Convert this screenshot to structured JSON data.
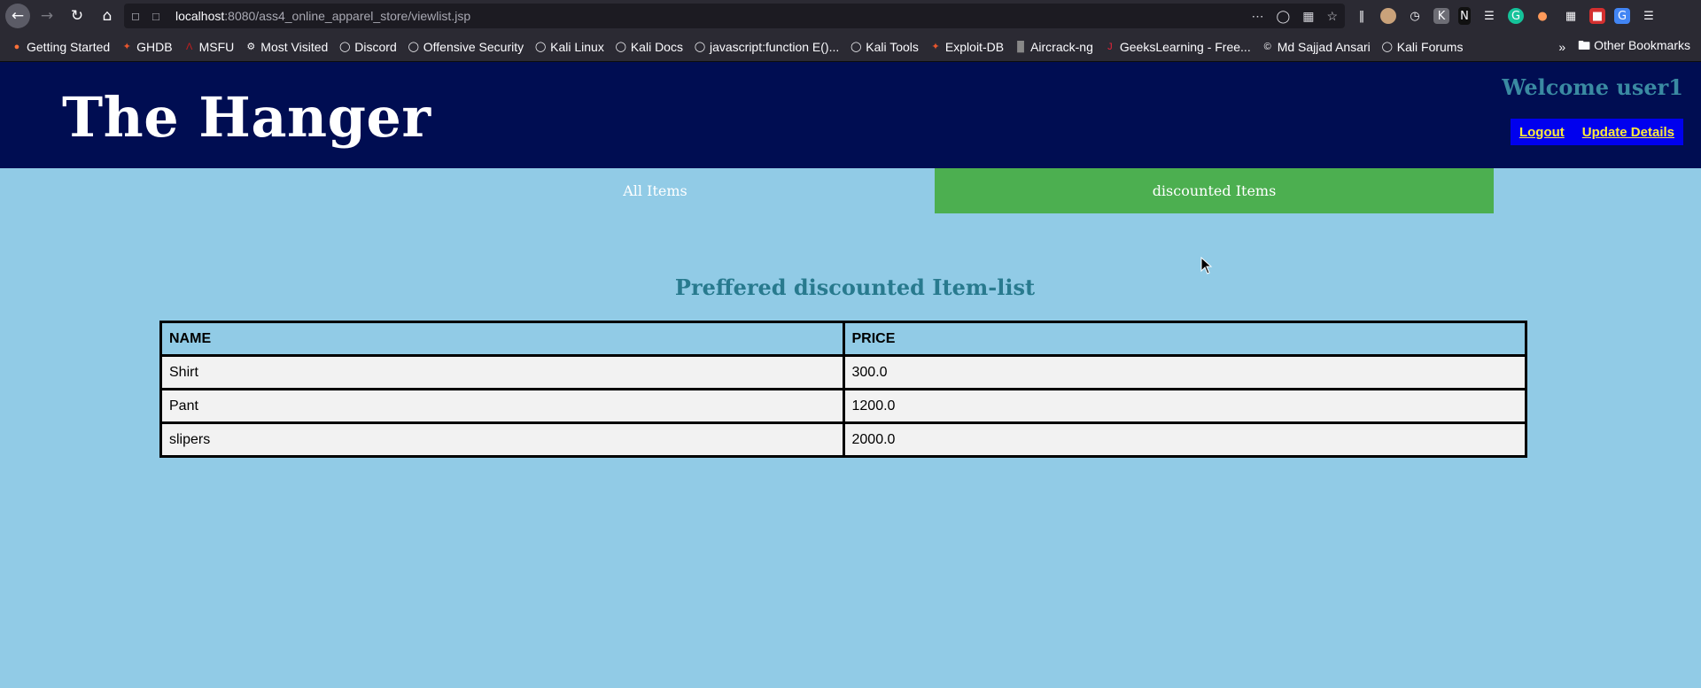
{
  "browser": {
    "url_host": "localhost",
    "url_rest": ":8080/ass4_online_apparel_store/viewlist.jsp",
    "bookmarks": [
      {
        "label": "Getting Started",
        "icon": "firefox-icon",
        "color": "#ff7139"
      },
      {
        "label": "GHDB",
        "icon": "exploit-db-icon",
        "color": "#e8552d"
      },
      {
        "label": "MSFU",
        "icon": "metasploit-icon",
        "color": "#c41e1e"
      },
      {
        "label": "Most Visited",
        "icon": "gear-icon",
        "color": "#fbfbfe"
      },
      {
        "label": "Discord",
        "icon": "globe-icon",
        "color": "#fbfbfe"
      },
      {
        "label": "Offensive Security",
        "icon": "globe-icon",
        "color": "#fbfbfe"
      },
      {
        "label": "Kali Linux",
        "icon": "globe-icon",
        "color": "#fbfbfe"
      },
      {
        "label": "Kali Docs",
        "icon": "globe-icon",
        "color": "#fbfbfe"
      },
      {
        "label": "javascript:function E()...",
        "icon": "globe-icon",
        "color": "#fbfbfe"
      },
      {
        "label": "Kali Tools",
        "icon": "globe-icon",
        "color": "#fbfbfe"
      },
      {
        "label": "Exploit-DB",
        "icon": "exploit-db-icon",
        "color": "#e8552d"
      },
      {
        "label": "Aircrack-ng",
        "icon": "aircrack-icon",
        "color": "#888888"
      },
      {
        "label": "GeeksLearning - Free...",
        "icon": "geekslearning-icon",
        "color": "#e8233a"
      },
      {
        "label": "Md Sajjad Ansari",
        "icon": "copyright-icon",
        "color": "#fbfbfe"
      },
      {
        "label": "Kali Forums",
        "icon": "globe-icon",
        "color": "#fbfbfe"
      }
    ],
    "other_bookmarks": "Other Bookmarks"
  },
  "header": {
    "site_title": "The Hanger",
    "welcome": "Welcome user1",
    "logout_label": "Logout",
    "update_label": "Update Details"
  },
  "tabs": {
    "all_items": "All Items",
    "discounted_items": "discounted Items",
    "active": "discounted Items"
  },
  "list": {
    "heading": "Preffered discounted Item-list",
    "columns": [
      "NAME",
      "PRICE"
    ],
    "rows": [
      {
        "name": "Shirt",
        "price": "300.0"
      },
      {
        "name": "Pant",
        "price": "1200.0"
      },
      {
        "name": "slipers",
        "price": "2000.0"
      }
    ]
  },
  "colors": {
    "header_bg": "#000d52",
    "page_bg": "#91cbe6",
    "active_tab": "#4caf50",
    "action_bar": "#0000ee",
    "action_link": "#ffeb3b"
  }
}
